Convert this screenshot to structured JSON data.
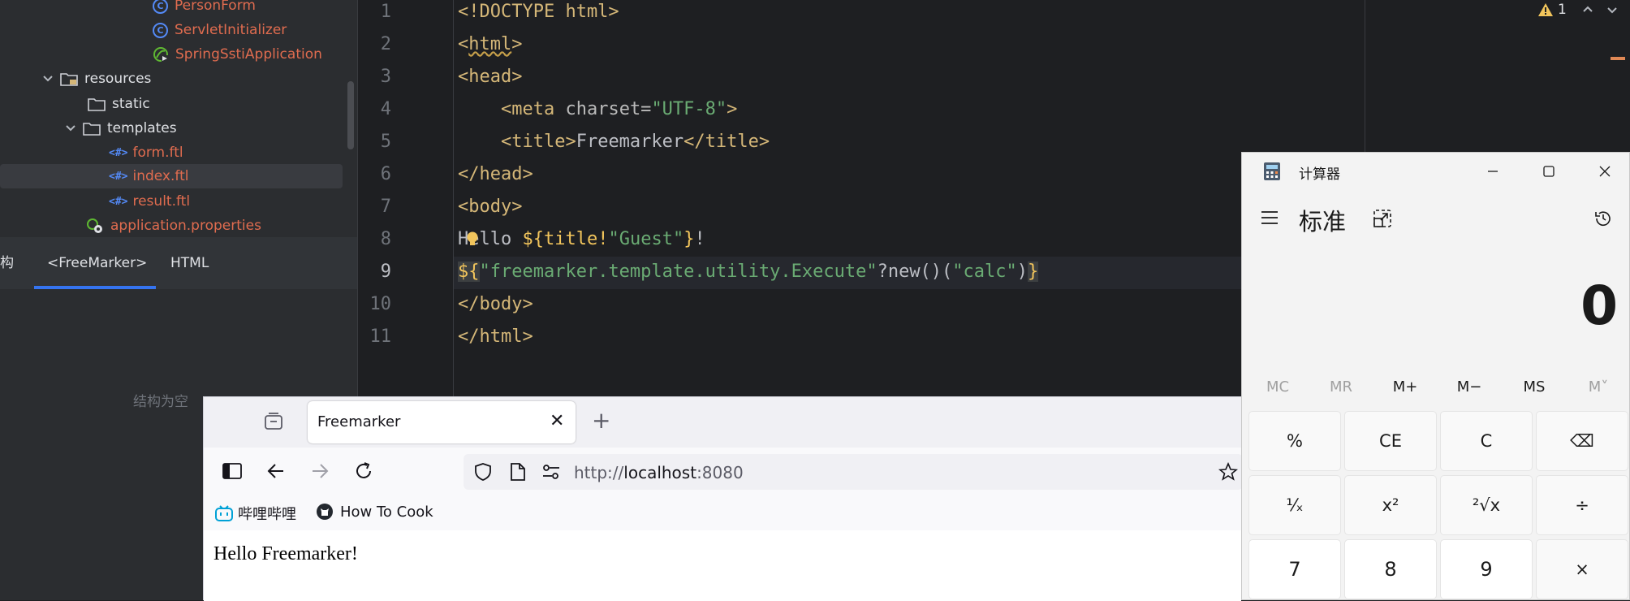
{
  "tree": {
    "items": [
      {
        "label": "PersonForm"
      },
      {
        "label": "ServletInitializer"
      },
      {
        "label": "SpringSstiApplication"
      },
      {
        "label": "resources"
      },
      {
        "label": "static"
      },
      {
        "label": "templates"
      },
      {
        "label": "form.ftl"
      },
      {
        "label": "index.ftl"
      },
      {
        "label": "result.ftl"
      },
      {
        "label": "application.properties"
      }
    ],
    "ftl_icon": "<#>"
  },
  "structure": {
    "tab_left": "构",
    "tab_freemarker": "<FreeMarker>",
    "tab_html": "HTML",
    "empty_text": "结构为空"
  },
  "editor": {
    "line_numbers": [
      "1",
      "2",
      "3",
      "4",
      "5",
      "6",
      "7",
      "8",
      "9",
      "10",
      "11"
    ],
    "warning_count": "1",
    "lines": {
      "l1": "<!DOCTYPE html>",
      "l2_open": "<",
      "l2_name": "html",
      "l2_close": ">",
      "l3": "<head>",
      "l4_open": "<meta ",
      "l4_attr": "charset=",
      "l4_val": "\"UTF-8\"",
      "l4_close": ">",
      "l5_open": "<title>",
      "l5_text": "Freemarker",
      "l5_close": "</title>",
      "l6": "</head>",
      "l7": "<body>",
      "l8_text": "Hello ",
      "l8_exp_open": "${",
      "l8_exp": "title!",
      "l8_str": "\"Guest\"",
      "l8_exp_close": "}",
      "l8_end": "!",
      "l9_open": "${",
      "l9_str": "\"freemarker.template.utility.Execute\"",
      "l9_mid": "?new()(",
      "l9_arg": "\"calc\"",
      "l9_paren": ")",
      "l9_close": "}",
      "l10": "</body>",
      "l11": "</html>"
    }
  },
  "browser": {
    "tab_title": "Freemarker",
    "url_prefix": "http://",
    "url_host": "localhost",
    "url_port": ":8080",
    "bookmarks": [
      "哔哩哔哩",
      "How To Cook"
    ],
    "page_text": "Hello Freemarker!"
  },
  "calculator": {
    "title": "计算器",
    "mode": "标准",
    "display": "0",
    "memory": [
      "MC",
      "MR",
      "M+",
      "M−",
      "MS",
      "M˅"
    ],
    "row1": [
      "%",
      "CE",
      "C",
      "⌫"
    ],
    "row2": [
      "¹⁄ₓ",
      "x²",
      "²√x",
      "÷"
    ],
    "row3": [
      "7",
      "8",
      "9",
      "×"
    ]
  }
}
